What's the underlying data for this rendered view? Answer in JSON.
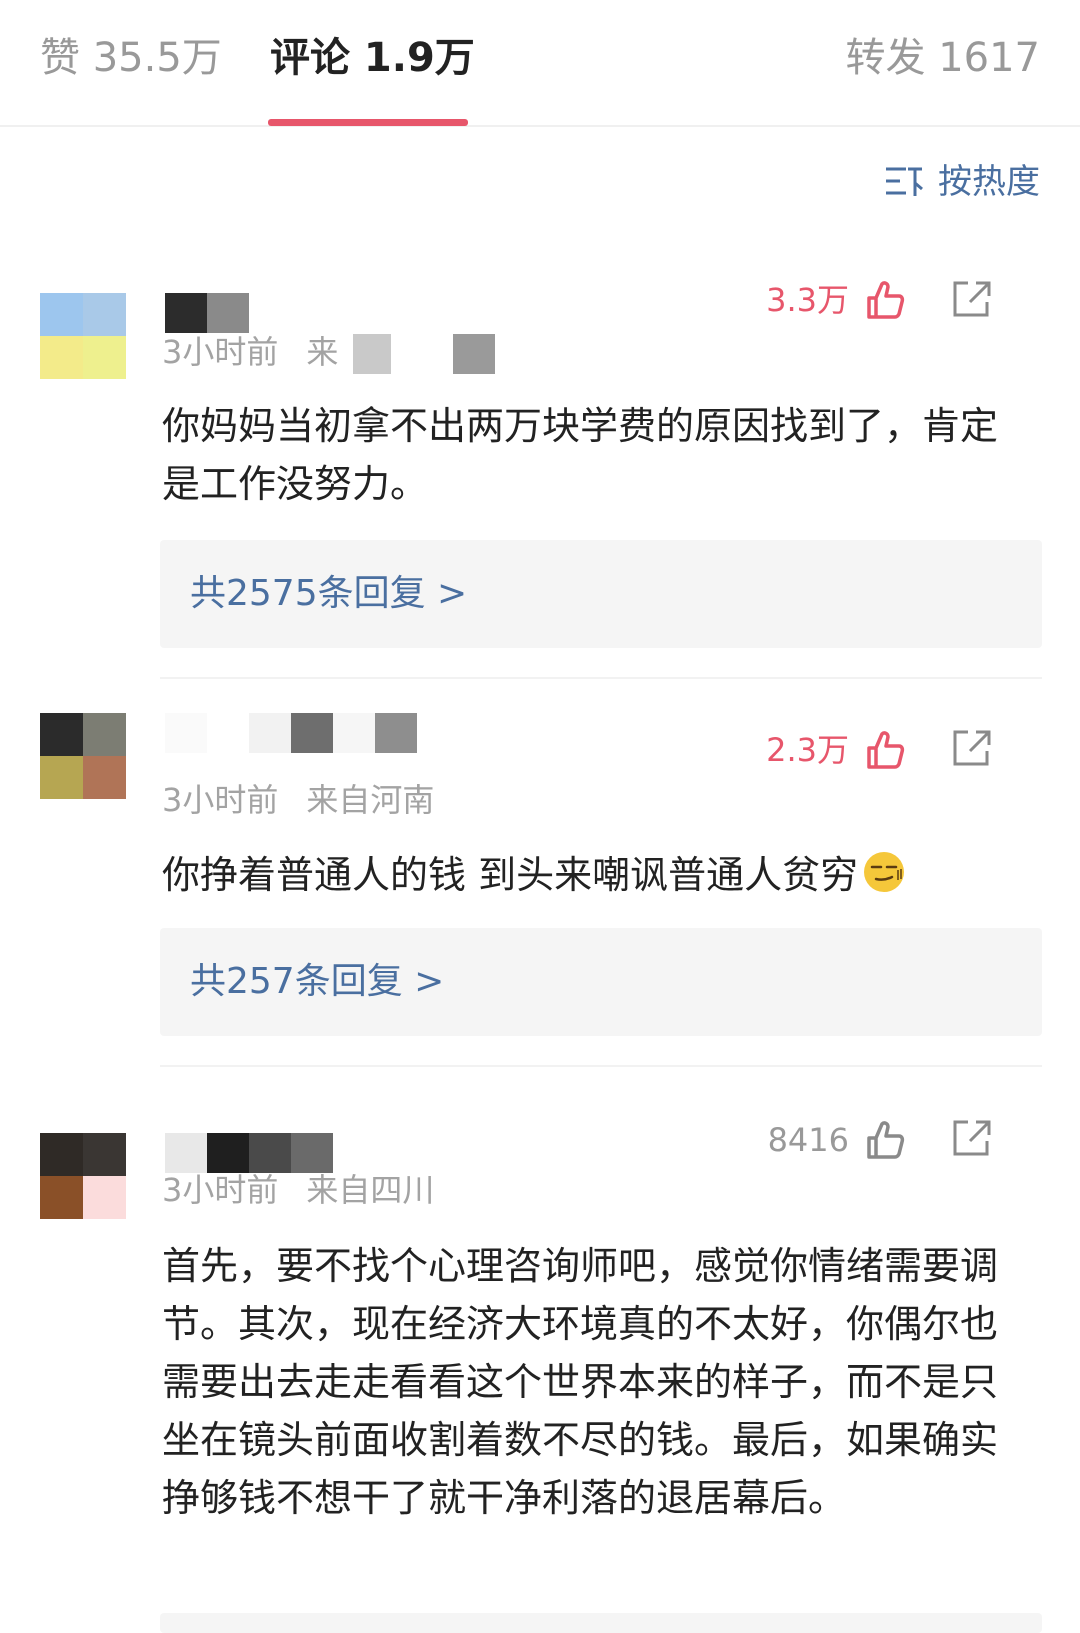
{
  "tabs": [
    {
      "label": "赞 35.5万"
    },
    {
      "label": "评论 1.9万"
    },
    {
      "label": "转发 1617"
    }
  ],
  "sort": {
    "label": "按热度",
    "icon": "sort-icon"
  },
  "colors": {
    "accent": "#e7566b",
    "link": "#4a6fa0",
    "meta": "#a3a3a3"
  },
  "comments": [
    {
      "time": "3小时前",
      "location": "来",
      "likes": "3.3万",
      "liked": true,
      "text": "你妈妈当初拿不出两万块学费的原因找到了，肯定是工作没努力。",
      "replies": "共2575条回复 >"
    },
    {
      "time": "3小时前",
      "location": "来自河南",
      "likes": "2.3万",
      "liked": true,
      "text": "你挣着普通人的钱 到头来嘲讽普通人贫穷",
      "emoji": "smirk-emoji",
      "replies": "共257条回复 >"
    },
    {
      "time": "3小时前",
      "location": "来自四川",
      "likes": "8416",
      "liked": false,
      "text": "首先，要不找个心理咨询师吧，感觉你情绪需要调节。其次，现在经济大环境真的不太好，你偶尔也需要出去走走看看这个世界本来的样子，而不是只坐在镜头前面收割着数不尽的钱。最后，如果确实挣够钱不想干了就干净利落的退居幕后。"
    }
  ]
}
